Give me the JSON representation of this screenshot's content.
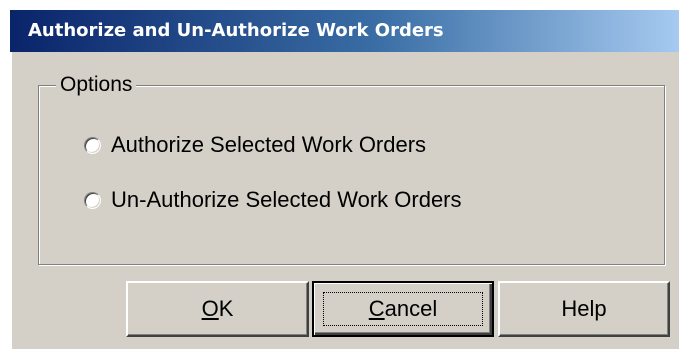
{
  "window": {
    "title": "Authorize and Un-Authorize Work Orders"
  },
  "options": {
    "legend": "Options",
    "items": [
      {
        "label": "Authorize Selected Work Orders",
        "selected": false
      },
      {
        "label": "Un-Authorize Selected Work Orders",
        "selected": false
      }
    ]
  },
  "buttons": {
    "ok": {
      "mnemonic": "O",
      "rest": "K"
    },
    "cancel": {
      "mnemonic": "C",
      "rest": "ancel"
    },
    "help": {
      "label": "Help"
    }
  },
  "colors": {
    "face": "#d4d0c8",
    "title_start": "#0a246a",
    "title_end": "#a6caf0"
  }
}
